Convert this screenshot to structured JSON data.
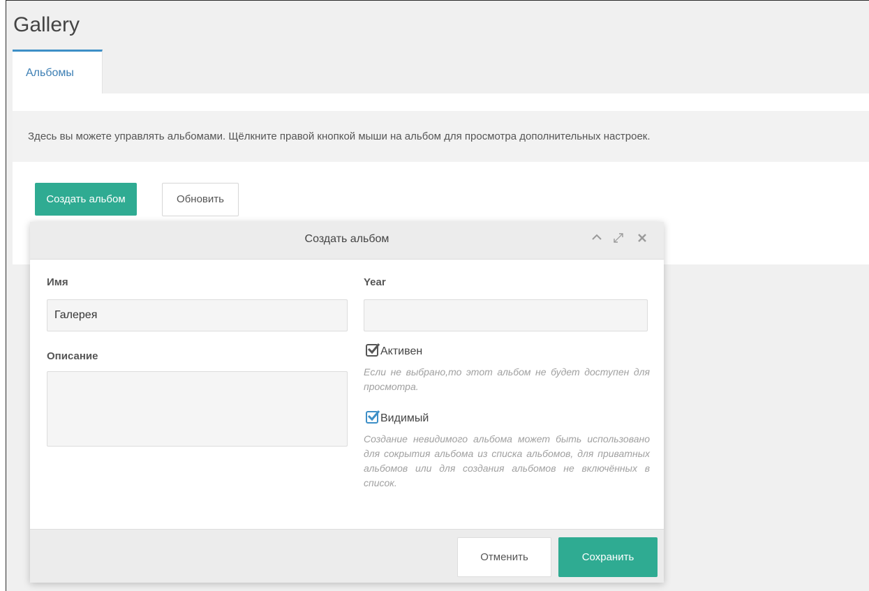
{
  "app": {
    "title": "Gallery"
  },
  "tabs": [
    {
      "label": "Альбомы",
      "active": true
    }
  ],
  "info_text": "Здесь вы можете управлять альбомами. Щёлкните правой кнопкой мыши на альбом для просмотра дополнительных настроек.",
  "toolbar": {
    "create_label": "Создать альбом",
    "refresh_label": "Обновить"
  },
  "dialog": {
    "title": "Создать альбом",
    "header_icons": [
      "chevron-up-icon",
      "expand-icon",
      "close-icon"
    ],
    "name_label": "Имя",
    "name_value": "Галерея",
    "year_label": "Year",
    "year_value": "",
    "description_label": "Описание",
    "description_value": "",
    "active": {
      "label": "Активен",
      "checked": true,
      "hint": "Если не выбрано,то этот альбом не будет доступен для просмотра."
    },
    "visible": {
      "label": "Видимый",
      "checked": true,
      "hint": "Создание невидимого альбома может быть использовано для сокрытия альбома из списка альбомов, для приватных альбомов или для создания альбомов не включённых в список."
    },
    "cancel_label": "Отменить",
    "save_label": "Сохранить"
  },
  "colors": {
    "accent": "#2fab92",
    "tab_accent": "#3d8fc7",
    "background": "#f0f0f0"
  }
}
